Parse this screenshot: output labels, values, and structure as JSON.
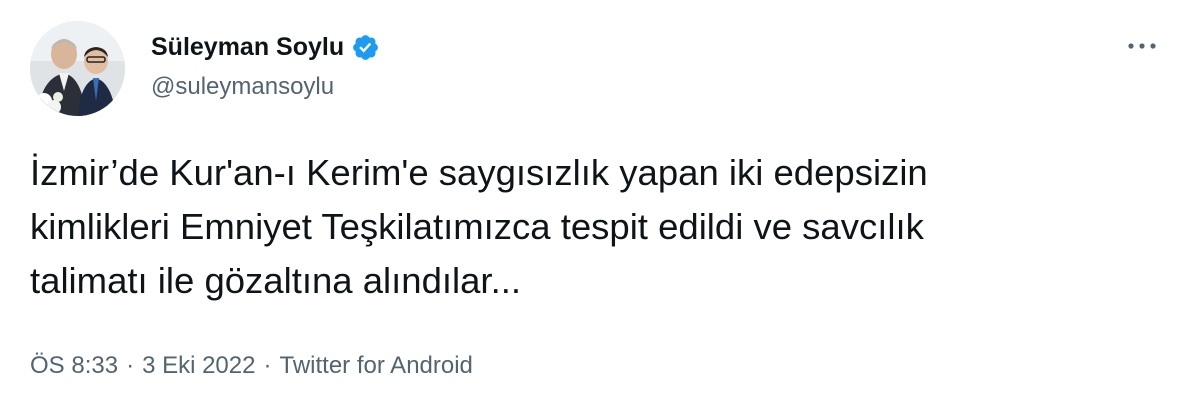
{
  "author": {
    "display_name": "Süleyman Soylu",
    "handle": "@suleymansoylu",
    "verified_icon": "verified-badge-icon",
    "avatar_icon": "profile-photo"
  },
  "menu": {
    "more_icon": "more-options-icon"
  },
  "tweet": {
    "lines": [
      "İzmir’de Kur'an-ı Kerim'e saygısızlık yapan iki edepsizin",
      "kimlikleri Emniyet Teşkilatımızca tespit edildi ve savcılık",
      "talimatı ile gözaltına alındılar..."
    ]
  },
  "meta": {
    "time": "ÖS 8:33",
    "separator": "·",
    "date": "3 Eki 2022",
    "source": "Twitter for Android"
  },
  "colors": {
    "text": "#0f1419",
    "secondary": "#536471",
    "verified": "#1d9bf0"
  }
}
